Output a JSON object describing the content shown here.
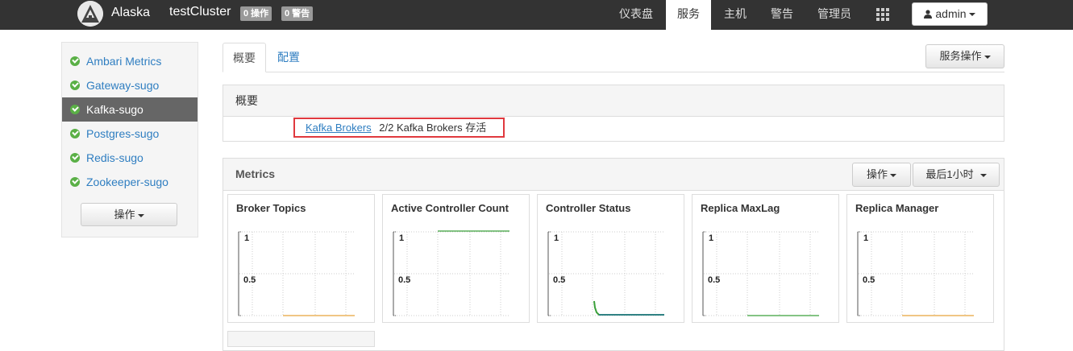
{
  "header": {
    "brand": "Alaska",
    "cluster": "testCluster",
    "ops_badge": "0 操作",
    "alerts_badge": "0 警告",
    "nav": [
      "仪表盘",
      "服务",
      "主机",
      "警告",
      "管理员"
    ],
    "active_nav": "服务",
    "user": "admin"
  },
  "sidebar": {
    "items": [
      {
        "label": "Ambari Metrics",
        "status": "ok"
      },
      {
        "label": "Gateway-sugo",
        "status": "ok"
      },
      {
        "label": "Kafka-sugo",
        "status": "ok",
        "active": true
      },
      {
        "label": "Postgres-sugo",
        "status": "ok"
      },
      {
        "label": "Redis-sugo",
        "status": "ok"
      },
      {
        "label": "Zookeeper-sugo",
        "status": "ok"
      }
    ],
    "ops_label": "操作"
  },
  "tabs": {
    "items": [
      "概要",
      "配置"
    ],
    "active": "概要",
    "service_ops": "服务操作"
  },
  "summary": {
    "title": "概要",
    "link": "Kafka Brokers",
    "text": "2/2 Kafka Brokers 存活"
  },
  "metrics": {
    "title": "Metrics",
    "ops_label": "操作",
    "range_label": "最后1小时",
    "cards": [
      {
        "title": "Broker Topics",
        "series_color": "#e8a33a"
      },
      {
        "title": "Active Controller Count",
        "series_color": "#3aa03a"
      },
      {
        "title": "Controller Status",
        "series_color": "#2a6fb0"
      },
      {
        "title": "Replica MaxLag",
        "series_color": "#3aa03a"
      },
      {
        "title": "Replica Manager",
        "series_color": "#e8a33a"
      }
    ],
    "tick_top": "1",
    "tick_mid": "0.5"
  },
  "colors": {
    "topbar": "#333333",
    "link": "#2f7ec1",
    "ok": "#5ab046",
    "highlight": "#e0393e"
  }
}
